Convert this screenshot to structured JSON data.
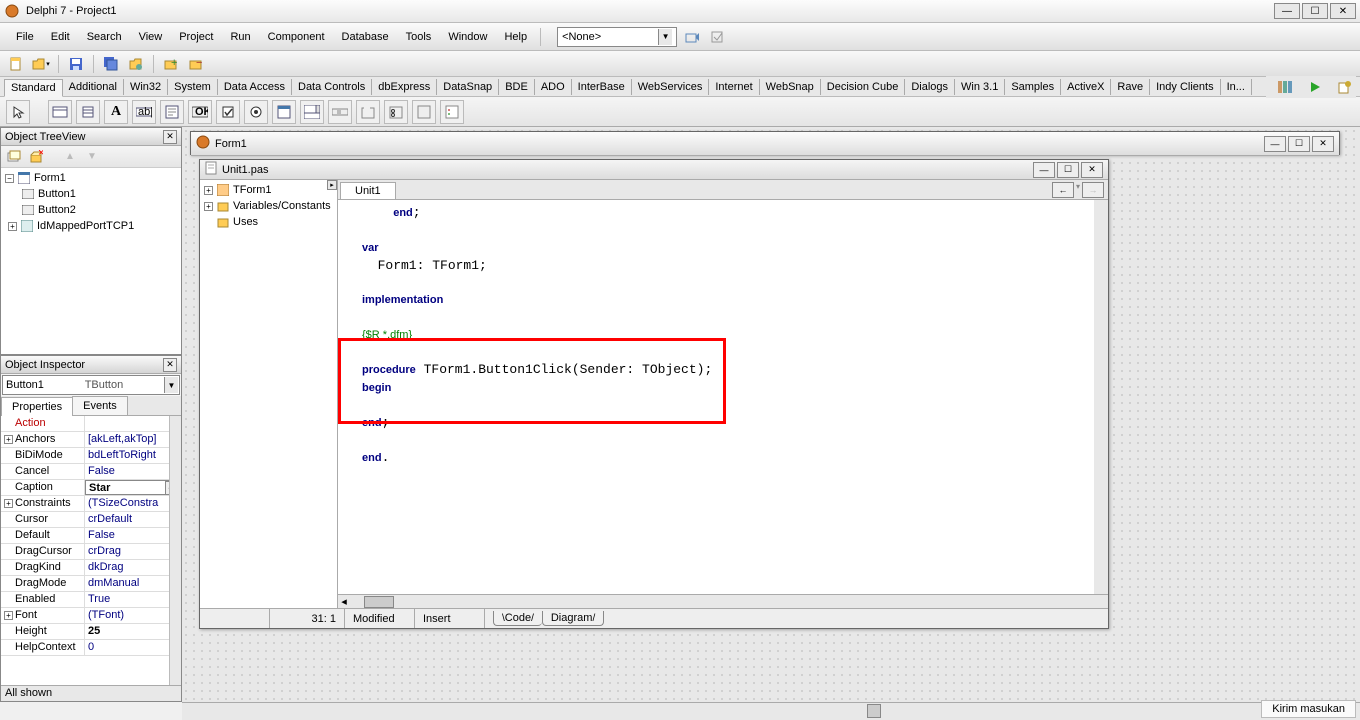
{
  "title": "Delphi 7 - Project1",
  "menus": [
    "File",
    "Edit",
    "Search",
    "View",
    "Project",
    "Run",
    "Component",
    "Database",
    "Tools",
    "Window",
    "Help"
  ],
  "combo_value": "<None>",
  "component_tabs": [
    "Standard",
    "Additional",
    "Win32",
    "System",
    "Data Access",
    "Data Controls",
    "dbExpress",
    "DataSnap",
    "BDE",
    "ADO",
    "InterBase",
    "WebServices",
    "Internet",
    "WebSnap",
    "Decision Cube",
    "Dialogs",
    "Win 3.1",
    "Samples",
    "ActiveX",
    "Rave",
    "Indy Clients",
    "In..."
  ],
  "treeview": {
    "title": "Object TreeView",
    "root": "Form1",
    "children": [
      "Button1",
      "Button2",
      "IdMappedPortTCP1"
    ]
  },
  "inspector": {
    "title": "Object Inspector",
    "obj_name": "Button1",
    "obj_type": "TButton",
    "tabs": [
      "Properties",
      "Events"
    ],
    "props": [
      {
        "n": "Action",
        "v": "",
        "exp": false,
        "sel": true
      },
      {
        "n": "Anchors",
        "v": "[akLeft,akTop]",
        "exp": true
      },
      {
        "n": "BiDiMode",
        "v": "bdLeftToRight",
        "exp": false
      },
      {
        "n": "Cancel",
        "v": "False",
        "exp": false
      },
      {
        "n": "Caption",
        "v": "Star",
        "exp": false,
        "bold": true,
        "editor": true
      },
      {
        "n": "Constraints",
        "v": "(TSizeConstra",
        "exp": true
      },
      {
        "n": "Cursor",
        "v": "crDefault",
        "exp": false
      },
      {
        "n": "Default",
        "v": "False",
        "exp": false
      },
      {
        "n": "DragCursor",
        "v": "crDrag",
        "exp": false
      },
      {
        "n": "DragKind",
        "v": "dkDrag",
        "exp": false
      },
      {
        "n": "DragMode",
        "v": "dmManual",
        "exp": false
      },
      {
        "n": "Enabled",
        "v": "True",
        "exp": false
      },
      {
        "n": "Font",
        "v": "(TFont)",
        "exp": true
      },
      {
        "n": "Height",
        "v": "25",
        "exp": false,
        "bold": true
      },
      {
        "n": "HelpContext",
        "v": "0",
        "exp": false
      }
    ],
    "status": "All shown"
  },
  "form_window": {
    "title": "Form1"
  },
  "code_window": {
    "file": "Unit1.pas",
    "tab": "Unit1",
    "tree_items": [
      "TForm1",
      "Variables/Constants",
      "Uses"
    ],
    "status_pos": "31: 1",
    "status_mod": "Modified",
    "status_ins": "Insert",
    "bottom_tabs": [
      "Code",
      "Diagram"
    ],
    "lines_before": "    end;\n\nvar\n  Form1: TForm1;\n\nimplementation\n",
    "dir_line": "{$R *.dfm}",
    "hl_line1": "procedure TForm1.Button1Click(Sender: TObject);",
    "hl_line2": "begin",
    "hl_line3": "",
    "hl_line4": "end;",
    "after": "\nend."
  },
  "feedback_label": "Kirim masukan"
}
